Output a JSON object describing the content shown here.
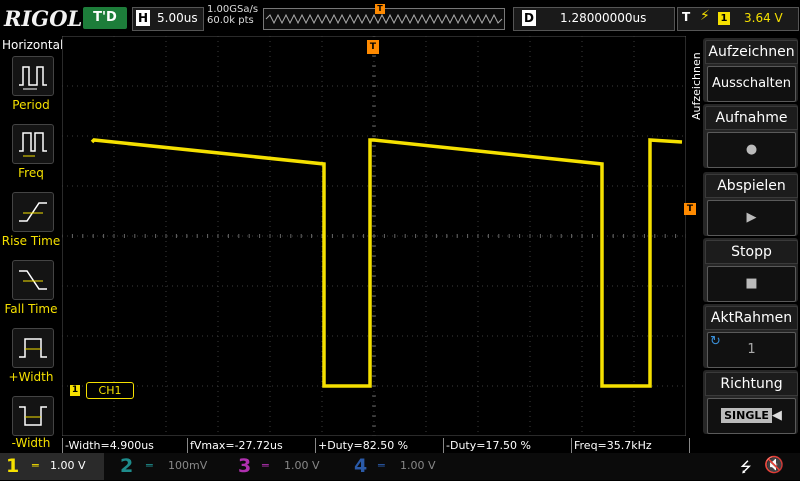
{
  "topbar": {
    "logo": "RIGOL",
    "trigger_state": "T'D",
    "horizontal_label": "H",
    "timebase": "5.00us",
    "sample_rate": "1.00GSa/s",
    "memory_depth": "60.0k pts",
    "delay_label": "D",
    "delay_value": "1.28000000us",
    "trigger_label": "T",
    "trigger_channel": "1",
    "trigger_level": "3.64 V"
  },
  "left_menu": {
    "title": "Horizontal",
    "items": [
      {
        "label": "Period",
        "icon": "period-icon"
      },
      {
        "label": "Freq",
        "icon": "frequency-icon"
      },
      {
        "label": "Rise Time",
        "icon": "rise-time-icon"
      },
      {
        "label": "Fall Time",
        "icon": "fall-time-icon"
      },
      {
        "label": "+Width",
        "icon": "positive-width-icon"
      },
      {
        "label": "-Width",
        "icon": "negative-width-icon"
      }
    ]
  },
  "right_menu": {
    "side_title": "Aufzeichnen",
    "items": [
      {
        "title": "Aufzeichnen",
        "value": "Ausschalten"
      },
      {
        "title": "Aufnahme",
        "value": "●"
      },
      {
        "title": "Abspielen",
        "value": "▶"
      },
      {
        "title": "Stopp",
        "value": "■"
      },
      {
        "title": "AktRahmen",
        "value": "1"
      },
      {
        "title": "Richtung",
        "value": "SINGLE"
      }
    ]
  },
  "waveform": {
    "channel_label": "CH1",
    "channel_marker": "1",
    "trigger_pos_marker": "T"
  },
  "measurements": [
    "-Width=4.900us",
    "fVmax=-27.72us",
    "+Duty=82.50 %",
    "-Duty=17.50 %",
    "Freq=35.7kHz"
  ],
  "channels": [
    {
      "num": "1",
      "scale": "1.00 V",
      "color": "#f5e000"
    },
    {
      "num": "2",
      "scale": "100mV",
      "color": "#1e8c8c"
    },
    {
      "num": "3",
      "scale": "1.00 V",
      "color": "#b030b0"
    },
    {
      "num": "4",
      "scale": "1.00 V",
      "color": "#2a5aa8"
    }
  ],
  "colors": {
    "ch1": "#f5e000",
    "grid": "#3c3c3c",
    "accent_orange": "#ff8a00"
  }
}
